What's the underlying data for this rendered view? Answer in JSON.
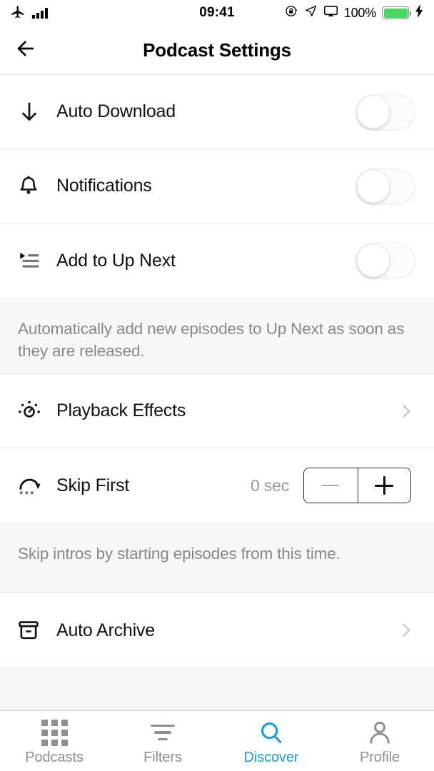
{
  "status_bar": {
    "airplane_icon": "airplane-icon",
    "signal_icon": "signal-bars-icon",
    "time": "09:41",
    "rotation_lock_icon": "rotation-lock-icon",
    "location_icon": "location-arrow-icon",
    "airplay_icon": "screen-mirroring-icon",
    "battery_percent": "100%",
    "battery_icon": "battery-icon",
    "charging_icon": "lightning-bolt-icon",
    "battery_color": "#4CD762"
  },
  "navbar": {
    "back_icon": "back-arrow-icon",
    "title": "Podcast Settings"
  },
  "settings": {
    "auto_download": {
      "icon": "download-arrow-icon",
      "label": "Auto Download",
      "toggle_state": "off"
    },
    "notifications": {
      "icon": "bell-icon",
      "label": "Notifications",
      "toggle_state": "off"
    },
    "add_to_up_next": {
      "icon": "playlist-queue-icon",
      "label": "Add to Up Next",
      "toggle_state": "off",
      "description": "Automatically add new episodes to Up Next as soon as they are released."
    },
    "playback_effects": {
      "icon": "speedometer-icon",
      "label": "Playback Effects",
      "chevron_icon": "chevron-right-icon"
    },
    "skip_first": {
      "icon": "skip-forward-icon",
      "label": "Skip First",
      "value": "0 sec",
      "decrement_icon": "minus-icon",
      "increment_icon": "plus-icon",
      "description": "Skip intros by starting episodes from this time."
    },
    "auto_archive": {
      "icon": "archive-box-icon",
      "label": "Auto Archive",
      "chevron_icon": "chevron-right-icon"
    }
  },
  "tabbar": {
    "active_color": "#1b9bdc",
    "inactive_color": "#8e8e8e",
    "tabs": [
      {
        "label": "Podcasts",
        "icon": "grid-icon",
        "active": false
      },
      {
        "label": "Filters",
        "icon": "filter-lines-icon",
        "active": false
      },
      {
        "label": "Discover",
        "icon": "search-icon",
        "active": true
      },
      {
        "label": "Profile",
        "icon": "person-icon",
        "active": false
      }
    ]
  }
}
